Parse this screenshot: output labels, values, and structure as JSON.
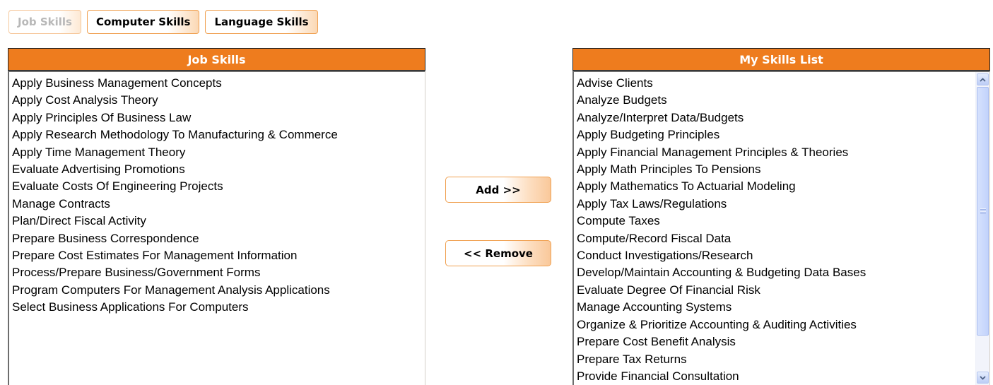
{
  "tabs": [
    {
      "label": "Job Skills",
      "active": true
    },
    {
      "label": "Computer Skills",
      "active": false
    },
    {
      "label": "Language Skills",
      "active": false
    }
  ],
  "job_skills": {
    "header": "Job Skills",
    "items": [
      "Apply Business Management Concepts",
      "Apply Cost Analysis Theory",
      "Apply Principles Of Business Law",
      "Apply Research Methodology To Manufacturing & Commerce",
      "Apply Time Management Theory",
      "Evaluate Advertising Promotions",
      "Evaluate Costs Of Engineering Projects",
      "Manage Contracts",
      "Plan/Direct Fiscal Activity",
      "Prepare Business Correspondence",
      "Prepare Cost Estimates For Management Information",
      "Process/Prepare Business/Government Forms",
      "Program Computers For Management Analysis Applications",
      "Select Business Applications For Computers"
    ]
  },
  "actions": {
    "add_label": "Add >>",
    "remove_label": "<< Remove"
  },
  "my_skills": {
    "header": "My Skills List",
    "items": [
      "Advise Clients",
      "Analyze Budgets",
      "Analyze/Interpret Data/Budgets",
      "Apply Budgeting Principles",
      "Apply Financial Management Principles & Theories",
      "Apply Math Principles To Pensions",
      "Apply Mathematics To Actuarial Modeling",
      "Apply Tax Laws/Regulations",
      "Compute Taxes",
      "Compute/Record Fiscal Data",
      "Conduct Investigations/Research",
      "Develop/Maintain Accounting & Budgeting Data Bases",
      "Evaluate Degree Of Financial Risk",
      "Manage Accounting Systems",
      "Organize & Prioritize Accounting & Auditing Activities",
      "Prepare Cost Benefit Analysis",
      "Prepare Tax Returns",
      "Provide Financial Consultation"
    ]
  },
  "colors": {
    "header_bg": "#ee7c1e",
    "header_text": "#ffffff",
    "tab_border": "#f0a050",
    "scrollbar": "#c2d3fb"
  },
  "icons": {
    "scroll_up": "chevron-up-icon",
    "scroll_down": "chevron-down-icon"
  }
}
